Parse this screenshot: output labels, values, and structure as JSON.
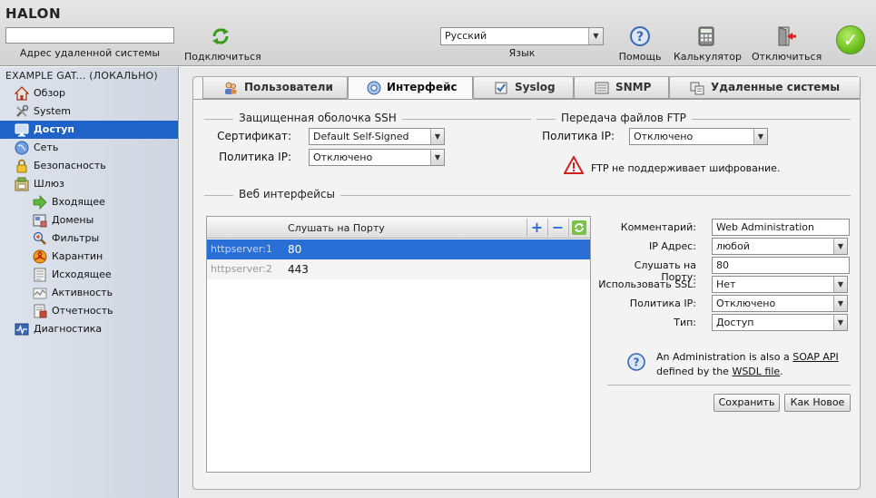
{
  "brand": "HALON",
  "toolbar": {
    "remote_value": "",
    "remote_label": "Адрес удаленной системы",
    "connect_label": "Подключиться",
    "language_value": "Русский",
    "language_label": "Язык",
    "help_label": "Помощь",
    "calculator_label": "Калькулятор",
    "disconnect_label": "Отключиться"
  },
  "sidebar": {
    "title": "EXAMPLE GAT... (ЛОКАЛЬНО)",
    "items": [
      {
        "label": "Обзор",
        "icon": "home-icon"
      },
      {
        "label": "System",
        "icon": "tools-icon"
      },
      {
        "label": "Доступ",
        "icon": "monitor-icon",
        "active": true
      },
      {
        "label": "Сеть",
        "icon": "globe-icon"
      },
      {
        "label": "Безопасность",
        "icon": "lock-icon"
      },
      {
        "label": "Шлюз",
        "icon": "gateway-icon"
      },
      {
        "label": "Входящее",
        "icon": "arrow-right-icon"
      },
      {
        "label": "Домены",
        "icon": "domains-icon"
      },
      {
        "label": "Фильтры",
        "icon": "filter-icon"
      },
      {
        "label": "Карантин",
        "icon": "hazard-icon"
      },
      {
        "label": "Исходящее",
        "icon": "outgoing-icon"
      },
      {
        "label": "Активность",
        "icon": "activity-icon"
      },
      {
        "label": "Отчетность",
        "icon": "report-icon"
      },
      {
        "label": "Диагностика",
        "icon": "diagnostics-icon"
      }
    ]
  },
  "tabs": [
    {
      "label": "Пользователи",
      "icon": "users-icon"
    },
    {
      "label": "Интерфейс",
      "icon": "interface-icon",
      "active": true
    },
    {
      "label": "Syslog",
      "icon": "syslog-icon"
    },
    {
      "label": "SNMP",
      "icon": "snmp-icon"
    },
    {
      "label": "Удаленные системы",
      "icon": "remote-systems-icon"
    }
  ],
  "ssh": {
    "title": "Защищенная оболочка SSH",
    "cert_label": "Сертификат:",
    "cert_value": "Default Self-Signed",
    "ip_label": "Политика IP:",
    "ip_value": "Отключено"
  },
  "ftp": {
    "title": "Передача файлов FTP",
    "ip_label": "Политика IP:",
    "ip_value": "Отключено",
    "warning": "FTP не поддерживает шифрование."
  },
  "web": {
    "title": "Веб интерфейсы",
    "list": {
      "header": "Слушать на Порту",
      "rows": [
        {
          "name": "httpserver:1",
          "port": "80",
          "selected": true
        },
        {
          "name": "httpserver:2",
          "port": "443",
          "selected": false
        }
      ]
    },
    "form": {
      "comment_label": "Комментарий:",
      "comment_value": "Web Administration",
      "ip_label": "IP Адрес:",
      "ip_value": "любой",
      "port_label": "Слушать на Порту:",
      "port_value": "80",
      "ssl_label": "Использовать SSL:",
      "ssl_value": "Нет",
      "policy_label": "Политика IP:",
      "policy_value": "Отключено",
      "type_label": "Тип:",
      "type_value": "Доступ"
    },
    "info": {
      "prefix": "An Administration is also a ",
      "soap": "SOAP API",
      "middle": "defined by the ",
      "wsdl": "WSDL file",
      "suffix": "."
    },
    "save_label": "Сохранить",
    "new_label": "Как Новое"
  },
  "colors": {
    "accent": "#1f63c9",
    "selected_row": "#2a6fd6",
    "warning": "#d11f1f",
    "ok": "#6cbf1f"
  }
}
